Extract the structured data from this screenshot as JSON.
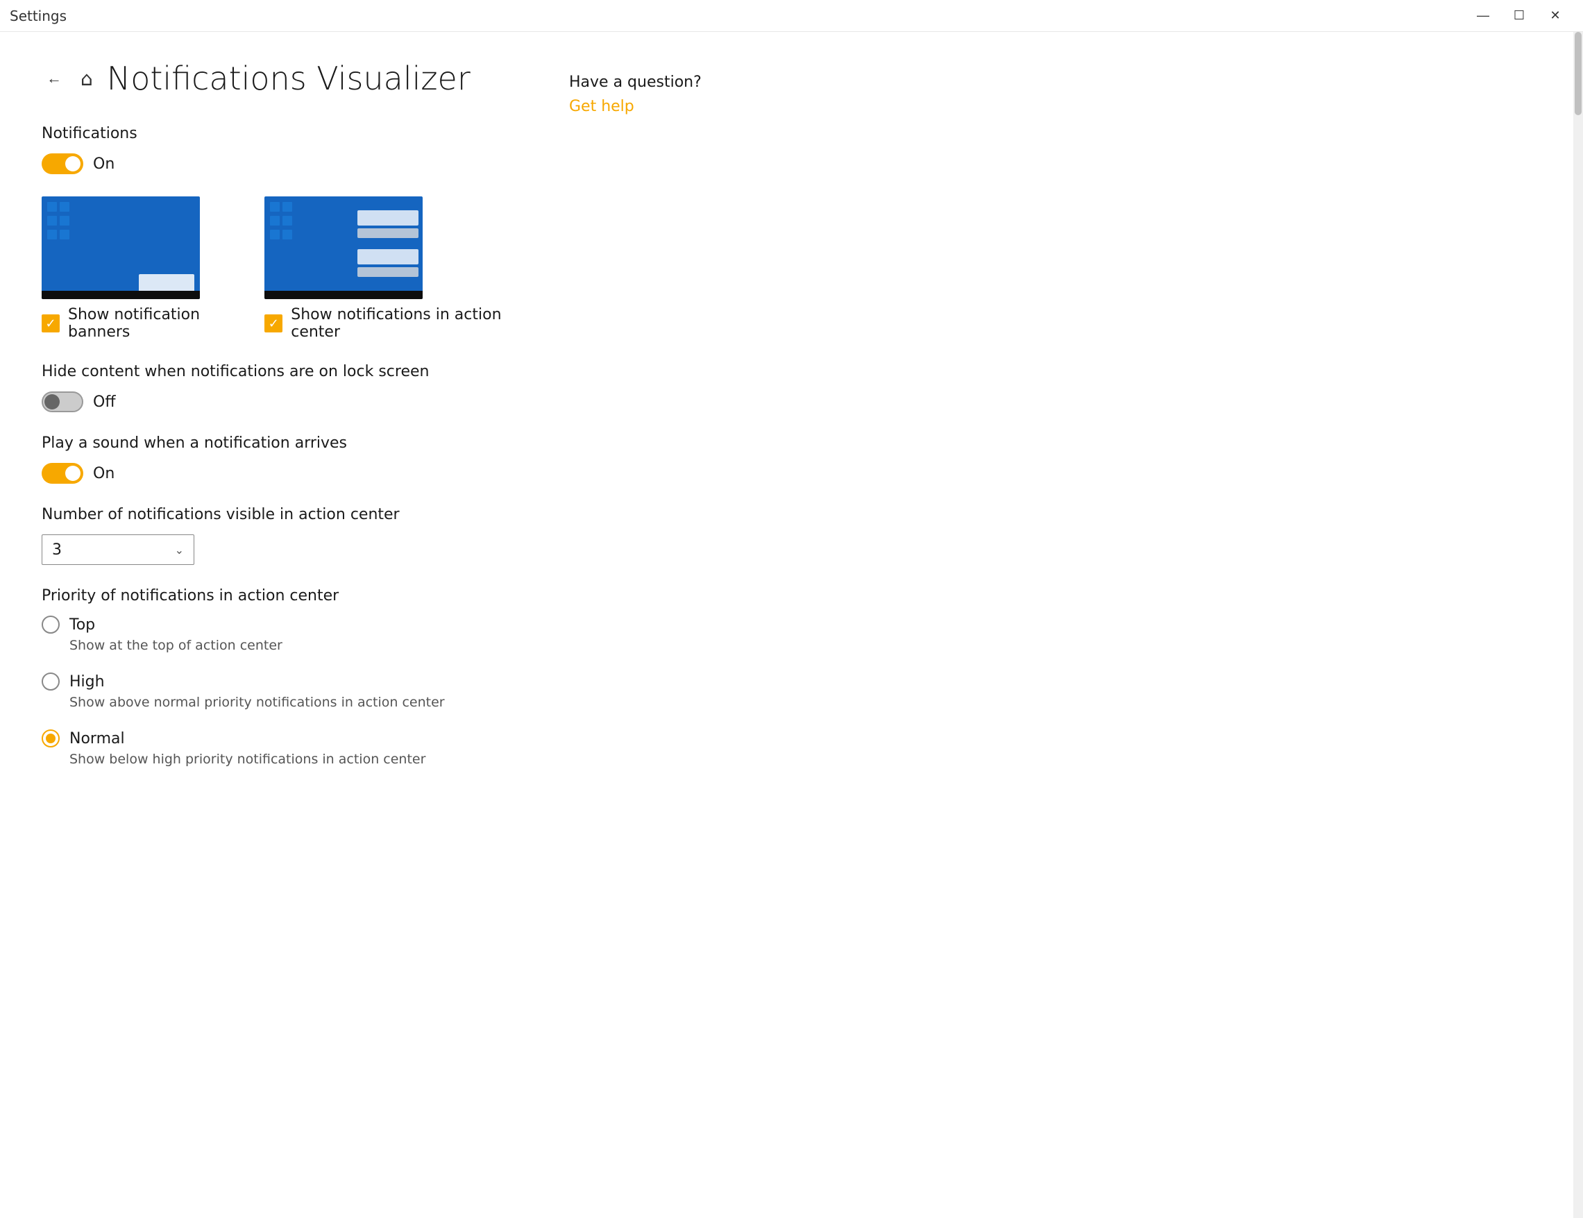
{
  "titlebar": {
    "title": "Settings",
    "minimize_label": "—",
    "maximize_label": "☐",
    "close_label": "✕"
  },
  "page": {
    "title": "Notifications Visualizer",
    "back_label": "←",
    "home_icon": "⌂"
  },
  "notifications": {
    "label": "Notifications",
    "toggle_state": "On",
    "toggle_on": true
  },
  "banner": {
    "checkbox_label": "Show notification banners",
    "checked": true
  },
  "action_center": {
    "checkbox_label": "Show notifications in action center",
    "checked": true
  },
  "lock_screen": {
    "label": "Hide content when notifications are on lock screen",
    "toggle_state": "Off",
    "toggle_on": false
  },
  "sound": {
    "label": "Play a sound when a notification arrives",
    "toggle_state": "On",
    "toggle_on": true
  },
  "visible_count": {
    "label": "Number of notifications visible in action center",
    "value": "3"
  },
  "priority": {
    "label": "Priority of notifications in action center",
    "options": [
      {
        "label": "Top",
        "desc": "Show at the top of action center",
        "selected": false
      },
      {
        "label": "High",
        "desc": "Show above normal priority notifications in action center",
        "selected": false
      },
      {
        "label": "Normal",
        "desc": "Show below high priority notifications in action center",
        "selected": true
      }
    ]
  },
  "sidebar": {
    "question": "Have a question?",
    "link": "Get help"
  }
}
